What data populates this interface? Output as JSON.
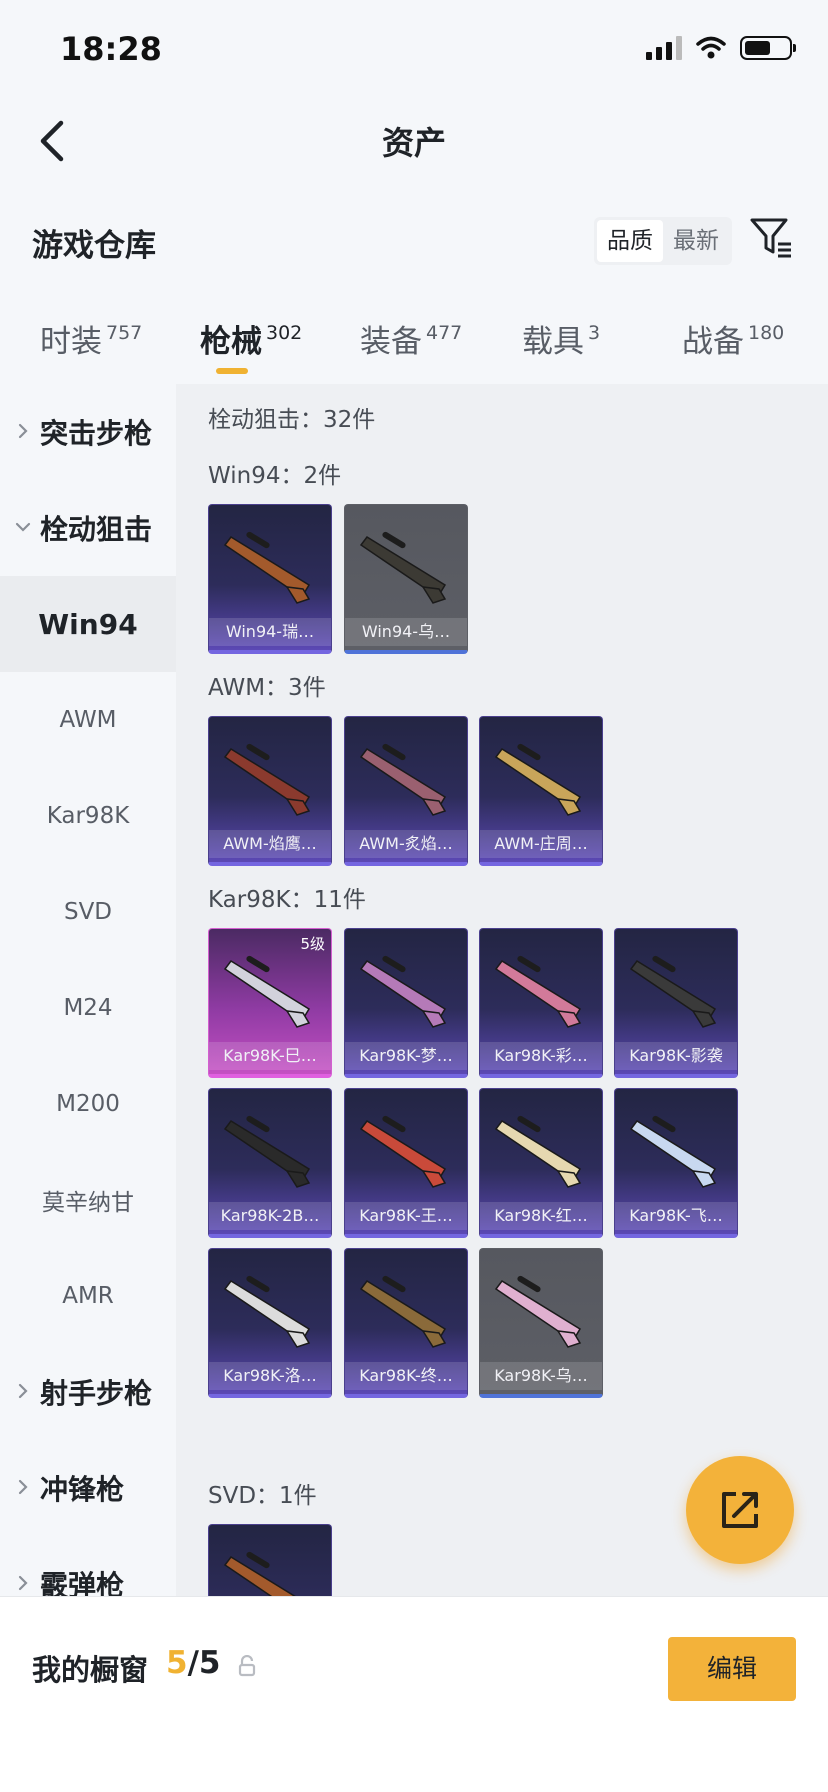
{
  "status": {
    "time": "18:28"
  },
  "nav": {
    "title": "资产"
  },
  "header": {
    "title": "游戏仓库",
    "sort_options": [
      "品质",
      "最新"
    ]
  },
  "tabs": [
    {
      "label": "时装",
      "count": "757"
    },
    {
      "label": "枪械",
      "count": "302"
    },
    {
      "label": "装备",
      "count": "477"
    },
    {
      "label": "载具",
      "count": "3"
    },
    {
      "label": "战备",
      "count": "180"
    }
  ],
  "sidebar": {
    "items": [
      {
        "label": "突击步枪",
        "type": "group"
      },
      {
        "label": "栓动狙击",
        "type": "group"
      },
      {
        "label": "Win94",
        "type": "sub"
      },
      {
        "label": "AWM",
        "type": "sub"
      },
      {
        "label": "Kar98K",
        "type": "sub"
      },
      {
        "label": "SVD",
        "type": "sub"
      },
      {
        "label": "M24",
        "type": "sub"
      },
      {
        "label": "M200",
        "type": "sub"
      },
      {
        "label": "莫辛纳甘",
        "type": "sub"
      },
      {
        "label": "AMR",
        "type": "sub"
      },
      {
        "label": "射手步枪",
        "type": "group"
      },
      {
        "label": "冲锋枪",
        "type": "group"
      },
      {
        "label": "霰弹枪",
        "type": "group"
      }
    ]
  },
  "content": {
    "total": "栓动狙击：32件",
    "groups": [
      {
        "title": "Win94：2件",
        "items": [
          {
            "name": "Win94-瑞…",
            "style": "purple"
          },
          {
            "name": "Win94-乌…",
            "style": "gray"
          }
        ]
      },
      {
        "title": "AWM：3件",
        "items": [
          {
            "name": "AWM-焰鹰…",
            "style": "purple"
          },
          {
            "name": "AWM-炙焰…",
            "style": "purple"
          },
          {
            "name": "AWM-庄周…",
            "style": "purple"
          }
        ]
      },
      {
        "title": "Kar98K：11件",
        "items": [
          {
            "name": "Kar98K-巳…",
            "style": "pink",
            "level": "5级"
          },
          {
            "name": "Kar98K-梦…",
            "style": "purple"
          },
          {
            "name": "Kar98K-彩…",
            "style": "purple"
          },
          {
            "name": "Kar98K-影袭",
            "style": "purple"
          },
          {
            "name": "Kar98K-2B…",
            "style": "purple"
          },
          {
            "name": "Kar98K-王…",
            "style": "purple"
          },
          {
            "name": "Kar98K-红…",
            "style": "purple"
          },
          {
            "name": "Kar98K-飞…",
            "style": "purple"
          },
          {
            "name": "Kar98K-洛…",
            "style": "purple"
          },
          {
            "name": "Kar98K-终…",
            "style": "purple"
          },
          {
            "name": "Kar98K-乌…",
            "style": "gray"
          }
        ]
      },
      {
        "title": "SVD：1件",
        "items": [
          {
            "name": "",
            "style": "purple"
          }
        ]
      }
    ]
  },
  "bottom": {
    "label": "我的橱窗",
    "count_current": "5",
    "count_total": "/5",
    "edit_label": "编辑"
  },
  "colors": {
    "accent": "#f3b23a",
    "rare_purple": "#5b48b4",
    "legendary_pink": "#c44fc3"
  }
}
